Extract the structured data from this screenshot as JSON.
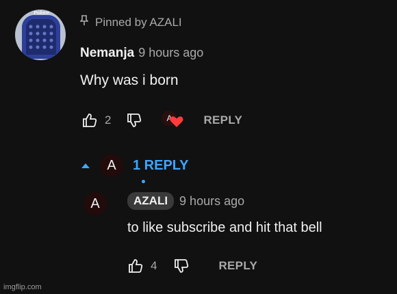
{
  "top_comment": {
    "avatar_text": "Pokem",
    "pinned_label": "Pinned by AZALI",
    "author": "Nemanja",
    "time": "9 hours ago",
    "text": "Why was i born",
    "likes": "2",
    "reply_label": "REPLY",
    "hearted_avatar_letter": "A"
  },
  "replies_toggle": {
    "avatar_letter": "A",
    "label": "1 REPLY"
  },
  "reply": {
    "avatar_letter": "A",
    "author": "AZALI",
    "time": "9 hours ago",
    "text": "to like subscribe and hit that bell",
    "likes": "4",
    "reply_label": "REPLY"
  },
  "watermark": "imgflip.com",
  "colors": {
    "background": "#111111",
    "link": "#3ea6ff",
    "heart": "#ff3b3b"
  }
}
